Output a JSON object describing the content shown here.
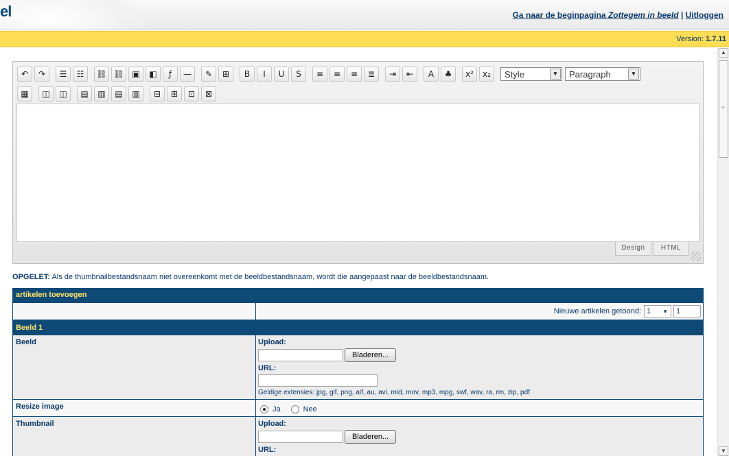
{
  "header": {
    "logo_fragment": "el",
    "home_link_prefix": "Ga naar de beginpagina ",
    "home_link_site": "Zottegem in beeld",
    "separator": "|",
    "logout_link": "Uitloggen"
  },
  "version": {
    "label": "Version:",
    "number": "1.7.11"
  },
  "colors": {
    "header_bar": "#ffdd55",
    "table_header": "#0f4a77",
    "table_header_text": "#ffe36a",
    "text": "#0b3a6a"
  },
  "toolbar": {
    "row1": [
      {
        "name": "undo-icon",
        "glyph": "↶"
      },
      {
        "name": "redo-icon",
        "glyph": "↷"
      },
      {
        "name": "ordered-list-icon",
        "glyph": "☰"
      },
      {
        "name": "unordered-list-icon",
        "glyph": "☷"
      },
      {
        "name": "insert-link-icon",
        "glyph": "⛓"
      },
      {
        "name": "remove-link-icon",
        "glyph": "⛓"
      },
      {
        "name": "insert-image-icon",
        "glyph": "▣"
      },
      {
        "name": "insert-media-icon",
        "glyph": "◧"
      },
      {
        "name": "insert-flash-icon",
        "glyph": "ƒ"
      },
      {
        "name": "horizontal-rule-icon",
        "glyph": "—"
      },
      {
        "name": "edit-source-icon",
        "glyph": "✎"
      },
      {
        "name": "show-borders-icon",
        "glyph": "⊞"
      },
      {
        "name": "bold-icon",
        "glyph": "B"
      },
      {
        "name": "italic-icon",
        "glyph": "I"
      },
      {
        "name": "underline-icon",
        "glyph": "U"
      },
      {
        "name": "strikethrough-icon",
        "glyph": "S"
      },
      {
        "name": "align-left-icon",
        "glyph": "≡"
      },
      {
        "name": "align-center-icon",
        "glyph": "≡"
      },
      {
        "name": "align-right-icon",
        "glyph": "≡"
      },
      {
        "name": "align-justify-icon",
        "glyph": "≣"
      },
      {
        "name": "indent-icon",
        "glyph": "⇥"
      },
      {
        "name": "outdent-icon",
        "glyph": "⇤"
      },
      {
        "name": "text-color-icon",
        "glyph": "A"
      },
      {
        "name": "highlight-color-icon",
        "glyph": "♣"
      },
      {
        "name": "superscript-icon",
        "glyph": "x²"
      },
      {
        "name": "subscript-icon",
        "glyph": "x₂"
      }
    ],
    "style_select": "Style",
    "paragraph_select": "Paragraph",
    "row2": [
      {
        "name": "insert-table-icon",
        "glyph": "▦"
      },
      {
        "name": "insert-column-left-icon",
        "glyph": "◫"
      },
      {
        "name": "insert-column-right-icon",
        "glyph": "◫"
      },
      {
        "name": "insert-row-icon",
        "glyph": "▤"
      },
      {
        "name": "insert-column-icon",
        "glyph": "▥"
      },
      {
        "name": "delete-row-icon",
        "glyph": "▤"
      },
      {
        "name": "delete-column-icon",
        "glyph": "▥"
      },
      {
        "name": "merge-cells-icon",
        "glyph": "⊟"
      },
      {
        "name": "split-cells-icon",
        "glyph": "⊞"
      },
      {
        "name": "cell-properties-icon",
        "glyph": "⊡"
      },
      {
        "name": "table-properties-icon",
        "glyph": "⊠"
      }
    ],
    "design_tab": "Design",
    "html_tab": "HTML"
  },
  "notice": {
    "label": "OPGELET:",
    "text": " Als de thumbnailbestandsnaam niet overeenkomt met de beeldbestandsnaam, wordt die aangepaast naar de beeldbestandsnaam."
  },
  "form": {
    "title": "artikelen toevoegen",
    "count_label": "Nieuwe artikelen getoond:",
    "count_select": "1",
    "count_input": "1",
    "section_title": "Beeld 1",
    "rows": {
      "beeld": {
        "label": "Beeld",
        "upload_label": "Upload:",
        "browse_button": "Bladeren...",
        "url_label": "URL:",
        "extensions": "Geldige extensies: jpg, gif, png, aif, au, avi, mid, mov, mp3, mpg, swf, wav, ra, rm, zip, pdf"
      },
      "resize": {
        "label": "Resize image",
        "option_yes": "Ja",
        "option_no": "Nee",
        "selected": "Ja"
      },
      "thumbnail": {
        "label": "Thumbnail",
        "upload_label": "Upload:",
        "browse_button": "Bladeren...",
        "url_label": "URL:"
      }
    }
  }
}
